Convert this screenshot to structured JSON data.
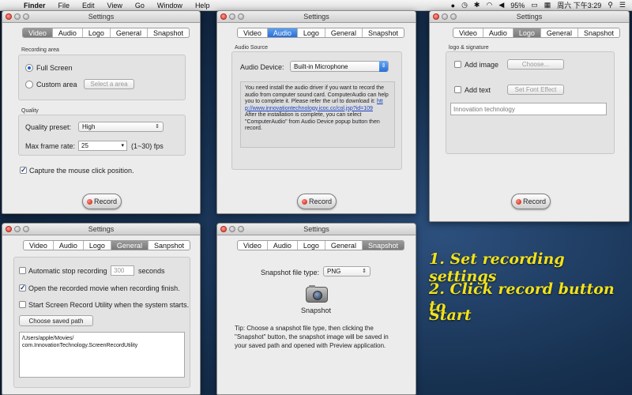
{
  "menubar": {
    "items": [
      "Finder",
      "File",
      "Edit",
      "View",
      "Go",
      "Window",
      "Help"
    ],
    "status": {
      "battery": "95%",
      "clock": "周六 下午3:29"
    }
  },
  "windows": {
    "video": {
      "title": "Settings",
      "tabs": [
        "Video",
        "Audio",
        "Logo",
        "General",
        "Snapshot"
      ],
      "recording_area_label": "Recording area",
      "full_screen": "Full Screen",
      "custom_area": "Custom area",
      "select_area_button": "Select a area",
      "quality_label": "Quality",
      "quality_preset_label": "Quality preset:",
      "quality_preset_value": "High",
      "max_frame_rate_label": "Max frame rate:",
      "max_frame_rate_value": "25",
      "frame_rate_hint": "(1~30) fps",
      "capture_click": "Capture the mouse click position.",
      "record_button": "Record"
    },
    "audio": {
      "title": "Settings",
      "tabs": [
        "Video",
        "Audio",
        "Logo",
        "General",
        "Snapshot"
      ],
      "audio_source_label": "Audio Source",
      "device_label": "Audio Device:",
      "device_value": "Built-in Microphone",
      "info_text_1": "You need install the audio driver if you want to record the audio from computer sound card. ComputerAudio can help you to complete it. Please refer the url to download it:",
      "info_link": "http://www.innovationtechnology.icoc.cc/col.jsp?id=109",
      "info_text_2": "After the installation is complete, you can select \"ComputerAudio\" from Audio Device popup button then record.",
      "record_button": "Record"
    },
    "logo": {
      "title": "Settings",
      "tabs": [
        "Video",
        "Audio",
        "Logo",
        "General",
        "Snapshot"
      ],
      "group_label": "logo & signature",
      "add_image": "Add image",
      "choose_button": "Choose...",
      "add_text": "Add text",
      "set_font_button": "Set Font Effect",
      "text_value": "Innovation technology",
      "record_button": "Record"
    },
    "general": {
      "title": "Settings",
      "tabs": [
        "Video",
        "Audio",
        "Logo",
        "General",
        "Sanpshot"
      ],
      "auto_stop_label": "Automatic stop recording",
      "auto_stop_value": "300",
      "auto_stop_unit": "seconds",
      "open_movie": "Open the recorded movie when recording finish.",
      "start_utility": "Start Screen Record Utility when the system starts.",
      "choose_path_button": "Choose saved path",
      "saved_path_line1": "/Users/apple/Movies/",
      "saved_path_line2": "com.InnovationTechnology.ScreenRecordUtility"
    },
    "snapshot": {
      "title": "Settings",
      "tabs": [
        "Video",
        "Audio",
        "Logo",
        "General",
        "Snapshot"
      ],
      "file_type_label": "Snapshot file type:",
      "file_type_value": "PNG",
      "snapshot_button": "Snapshot",
      "tip": "Tip: Choose a snapshot file type, then clicking the \"Snapshot\" button, the snapshot image will be saved in your saved path and opened with Preview application."
    }
  },
  "instructions": {
    "step1": "1. Set recording settings",
    "step2a": "2. Click record button to",
    "step2b": "Start"
  }
}
